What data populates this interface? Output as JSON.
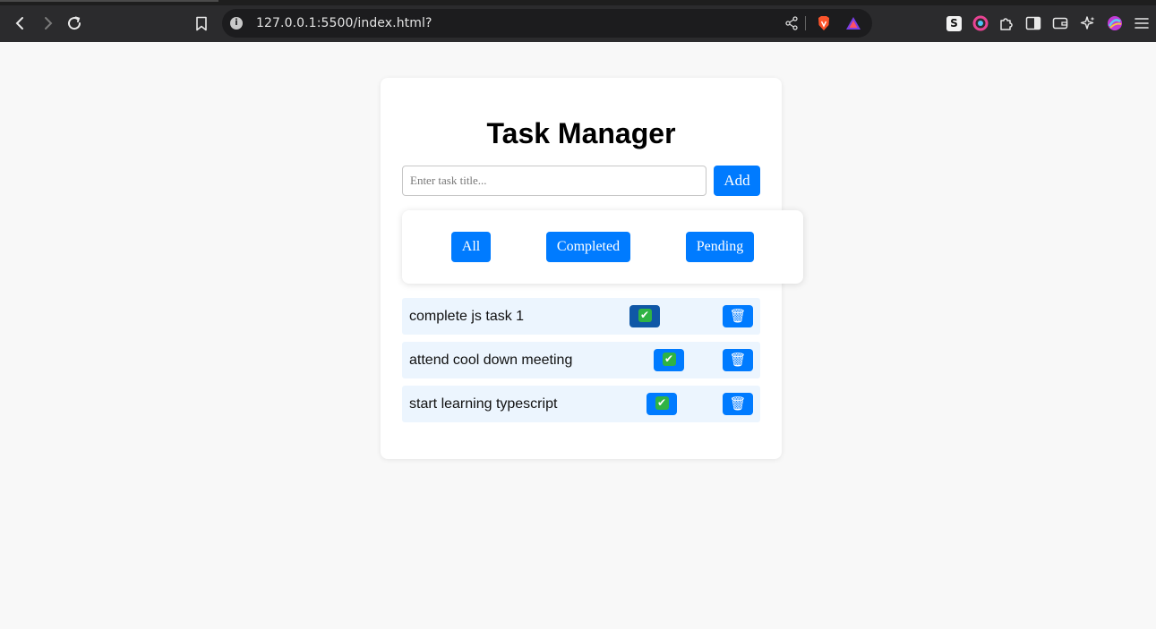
{
  "browser": {
    "url": "127.0.0.1:5500/index.html?",
    "info_icon_glyph": "i",
    "extension_s_label": "S",
    "icons": [
      "back-icon",
      "forward-icon",
      "reload-icon",
      "bookmark-icon",
      "info-icon",
      "share-icon",
      "brave-shield-icon",
      "rewards-icon",
      "s-extension-icon",
      "color-extension-icon",
      "puzzle-extensions-icon",
      "sidebar-icon",
      "wallet-icon",
      "leo-ai-icon",
      "profile-icon",
      "menu-icon"
    ]
  },
  "app": {
    "title": "Task Manager",
    "input_placeholder": "Enter task title...",
    "input_value": "",
    "add_label": "Add",
    "filters": {
      "all": "All",
      "completed": "Completed",
      "pending": "Pending"
    },
    "accent_color": "#007bff",
    "tasks": [
      {
        "title": "complete js task 1",
        "done_icon": "✔",
        "delete_icon": "🗑",
        "completed": true
      },
      {
        "title": "attend cool down meeting",
        "done_icon": "✔",
        "delete_icon": "🗑",
        "completed": false
      },
      {
        "title": "start learning typescript",
        "done_icon": "✔",
        "delete_icon": "🗑",
        "completed": false
      }
    ]
  }
}
